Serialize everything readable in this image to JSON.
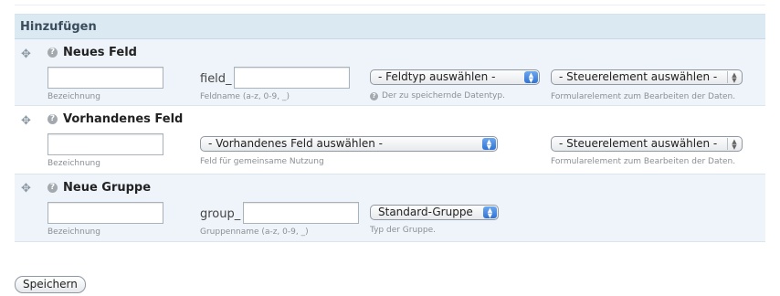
{
  "panel": {
    "title": "Hinzufügen"
  },
  "new_field": {
    "title": "Neues Feld",
    "label_desc": "Bezeichnung",
    "name_prefix": "field_",
    "name_desc": "Feldname (a-z, 0-9, _)",
    "type_select": "- Feldtyp auswählen -",
    "type_desc": "Der zu speichernde Datentyp.",
    "widget_select": "- Steuerelement auswählen -",
    "widget_desc": "Formularelement zum Bearbeiten der Daten."
  },
  "existing_field": {
    "title": "Vorhandenes Feld",
    "label_desc": "Bezeichnung",
    "field_select": "- Vorhandenes Feld auswählen -",
    "field_desc": "Feld für gemeinsame Nutzung",
    "widget_select": "- Steuerelement auswählen -",
    "widget_desc": "Formularelement zum Bearbeiten der Daten."
  },
  "new_group": {
    "title": "Neue Gruppe",
    "label_desc": "Bezeichnung",
    "name_prefix": "group_",
    "name_desc": "Gruppenname (a-z, 0-9, _)",
    "type_select": "Standard-Gruppe",
    "type_desc": "Typ der Gruppe."
  },
  "actions": {
    "save": "Speichern"
  },
  "icons": {
    "drag": "drag-handle-icon",
    "help": "help-icon",
    "select_arrow": "select-arrows-icon"
  }
}
